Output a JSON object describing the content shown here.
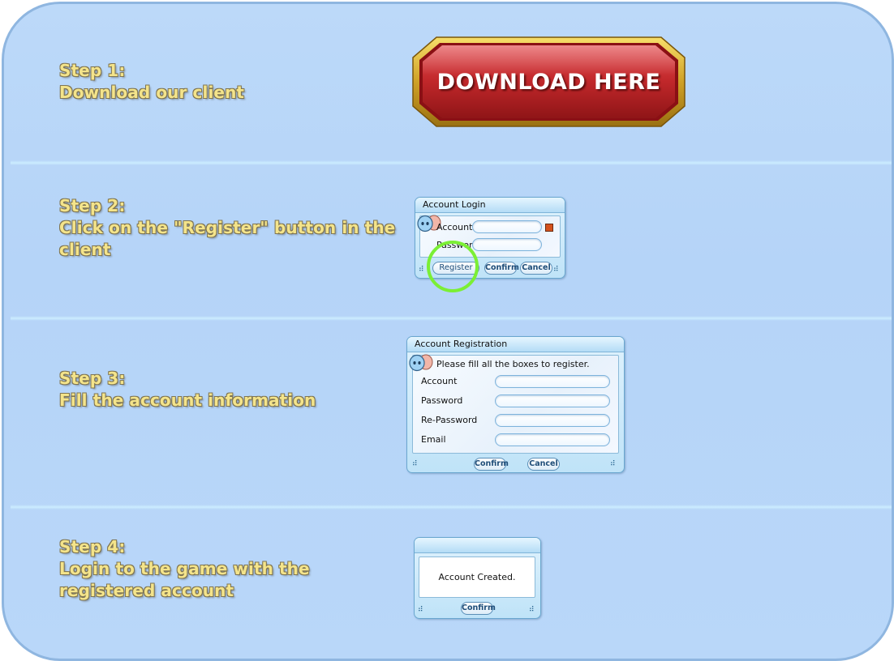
{
  "steps": [
    {
      "heading": "Step 1:",
      "lines": [
        "Download our client"
      ]
    },
    {
      "heading": "Step 2:",
      "lines": [
        "Click on the \"Register\" button in the",
        "client"
      ]
    },
    {
      "heading": "Step 3:",
      "lines": [
        "Fill the account information"
      ]
    },
    {
      "heading": "Step 4:",
      "lines": [
        "Login to the game with the",
        "registered account"
      ]
    }
  ],
  "download_button": {
    "label": "DOWNLOAD HERE"
  },
  "login_dialog": {
    "title": "Account  Login",
    "account_label": "Account",
    "password_label": "Password",
    "register_button": "Register",
    "confirm_button": "Confirm",
    "cancel_button": "Cancel"
  },
  "registration_dialog": {
    "title": "Account  Registration",
    "instructions": "Please fill all the boxes to register.",
    "fields": [
      "Account",
      "Password",
      "Re-Password",
      "Email"
    ],
    "confirm_button": "Confirm",
    "cancel_button": "Cancel"
  },
  "created_dialog": {
    "message": "Account  Created.",
    "confirm_button": "Confirm"
  },
  "colors": {
    "background": "#b9d7f9",
    "step_text": "#f4e48a",
    "download_red": "#c0272a",
    "download_gold": "#d9b331",
    "highlight_circle": "#7bef35"
  },
  "icons": [
    "ghost-avatar-icon",
    "resize-grip-icon",
    "close-square-icon"
  ]
}
